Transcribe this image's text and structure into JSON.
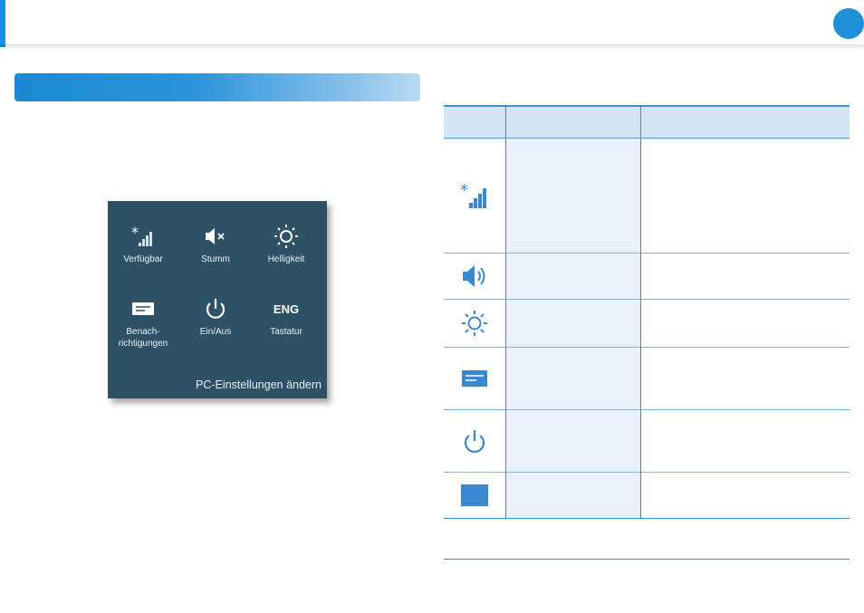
{
  "panel": {
    "tiles": [
      {
        "label": "Verfügbar",
        "icon": "signal-icon"
      },
      {
        "label": "Stumm",
        "icon": "mute-icon"
      },
      {
        "label": "Helligkeit",
        "icon": "brightness-icon"
      },
      {
        "label": "Benach-\nrichtigungen",
        "icon": "notification-icon"
      },
      {
        "label": "Ein/Aus",
        "icon": "power-icon"
      },
      {
        "label": "Tastatur",
        "icon": "keyboard-icon",
        "glyph": "ENG"
      }
    ],
    "settings_link": "PC-Einstellungen ändern"
  },
  "table": {
    "icons": [
      "signal-icon",
      "speaker-icon",
      "brightness-icon",
      "notification-icon",
      "power-icon",
      "keyboard-icon"
    ]
  },
  "colors": {
    "accent": "#1e8fd8",
    "panel_bg": "#2d5266",
    "table_header": "#d3e6f6",
    "table_col": "#e6f1fb"
  }
}
